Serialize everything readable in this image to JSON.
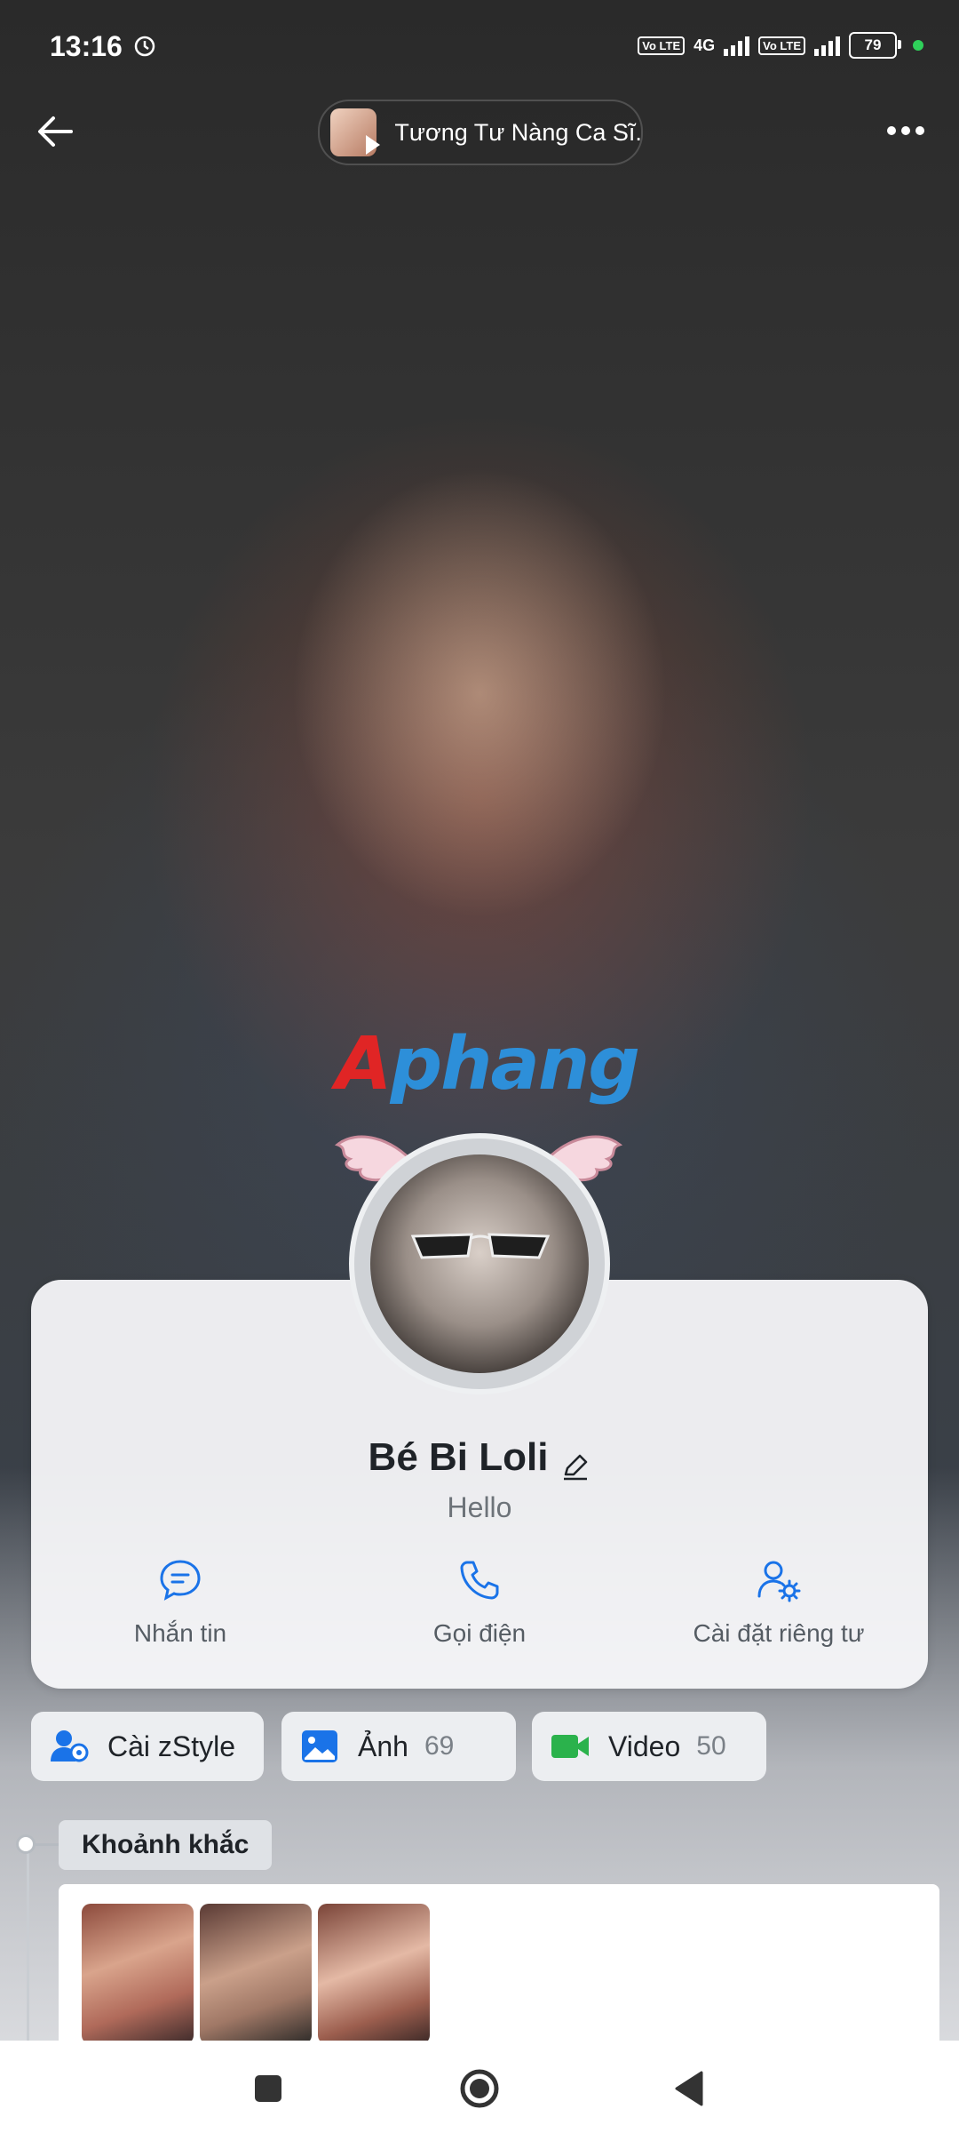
{
  "status_bar": {
    "time": "13:16",
    "volte_1": "Vo LTE",
    "network": "4G",
    "volte_2": "Vo LTE",
    "battery": "79"
  },
  "header": {
    "music_title": "Tương Tư Nàng Ca Sĩ.."
  },
  "watermark": {
    "first_letter": "A",
    "rest": "phang"
  },
  "profile": {
    "name": "Bé Bi Loli",
    "bio": "Hello"
  },
  "actions": [
    {
      "label": "Nhắn tin",
      "icon": "message-icon"
    },
    {
      "label": "Gọi điện",
      "icon": "phone-icon"
    },
    {
      "label": "Cài đặt riêng tư",
      "icon": "privacy-settings-icon"
    }
  ],
  "chips": {
    "zstyle": {
      "label": "Cài zStyle"
    },
    "photos": {
      "label": "Ảnh",
      "count": "69"
    },
    "videos": {
      "label": "Video",
      "count": "50"
    }
  },
  "moments": {
    "title": "Khoảnh khắc"
  },
  "colors": {
    "accent": "#1a73e8",
    "video_green": "#2bb24c",
    "chip_bg": "#eceef1"
  }
}
